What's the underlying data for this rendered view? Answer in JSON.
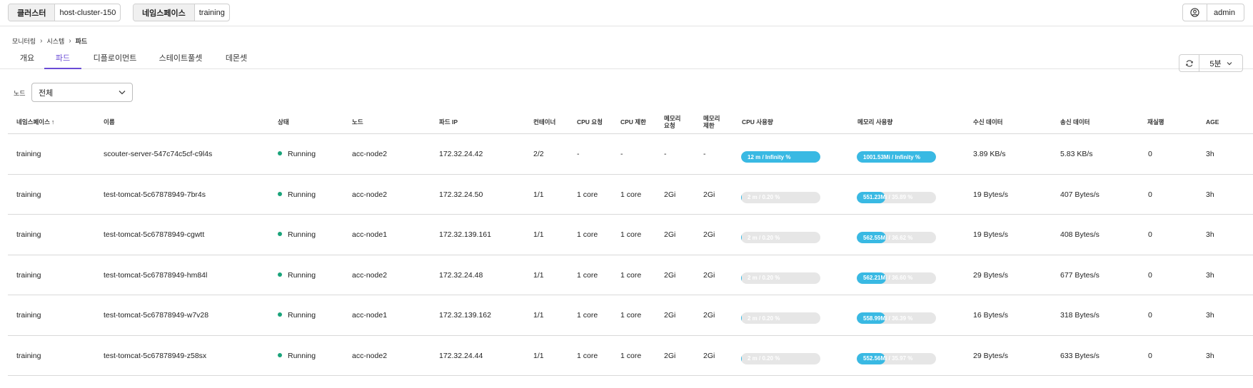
{
  "header": {
    "cluster_label": "클러스터",
    "cluster_value": "host-cluster-150",
    "namespace_label": "네임스페이스",
    "namespace_value": "training",
    "user_name": "admin"
  },
  "breadcrumb": [
    "모니터링",
    "시스템",
    "파드"
  ],
  "tabs": [
    {
      "label": "개요",
      "active": false
    },
    {
      "label": "파드",
      "active": true
    },
    {
      "label": "디플로이먼트",
      "active": false
    },
    {
      "label": "스테이트풀셋",
      "active": false
    },
    {
      "label": "데몬셋",
      "active": false
    }
  ],
  "toolbar": {
    "interval": "5분"
  },
  "filter": {
    "label": "노드",
    "value": "전체"
  },
  "columns": [
    "네임스페이스",
    "이름",
    "상태",
    "노드",
    "파드 IP",
    "컨테이너",
    "CPU 요청",
    "CPU 제한",
    "메모리 요청",
    "메모리 제한",
    "CPU 사용량",
    "메모리 사용량",
    "수신 데이터",
    "송신 데이터",
    "재실행",
    "AGE"
  ],
  "sort": {
    "column": "네임스페이스",
    "direction": "asc"
  },
  "rows": [
    {
      "namespace": "training",
      "name": "scouter-server-547c74c5cf-c9l4s",
      "status": "Running",
      "node": "acc-node2",
      "ip": "172.32.24.42",
      "containers": "2/2",
      "cpu_req": "-",
      "cpu_lim": "-",
      "mem_req": "-",
      "mem_lim": "-",
      "cpu_usage": "12 m / Infinity %",
      "cpu_pct": 100,
      "mem_usage": "1001.53Mi / Infinity %",
      "mem_pct": 100,
      "rx": "3.89 KB/s",
      "tx": "5.83 KB/s",
      "restarts": "0",
      "age": "3h"
    },
    {
      "namespace": "training",
      "name": "test-tomcat-5c67878949-7br4s",
      "status": "Running",
      "node": "acc-node2",
      "ip": "172.32.24.50",
      "containers": "1/1",
      "cpu_req": "1 core",
      "cpu_lim": "1 core",
      "mem_req": "2Gi",
      "mem_lim": "2Gi",
      "cpu_usage": "2 m / 0.20 %",
      "cpu_pct": 0.2,
      "mem_usage": "551.23Mi / 35.89 %",
      "mem_pct": 35.89,
      "rx": "19 Bytes/s",
      "tx": "407 Bytes/s",
      "restarts": "0",
      "age": "3h"
    },
    {
      "namespace": "training",
      "name": "test-tomcat-5c67878949-cgwtt",
      "status": "Running",
      "node": "acc-node1",
      "ip": "172.32.139.161",
      "containers": "1/1",
      "cpu_req": "1 core",
      "cpu_lim": "1 core",
      "mem_req": "2Gi",
      "mem_lim": "2Gi",
      "cpu_usage": "2 m / 0.20 %",
      "cpu_pct": 0.2,
      "mem_usage": "562.55Mi / 36.62 %",
      "mem_pct": 36.62,
      "rx": "19 Bytes/s",
      "tx": "408 Bytes/s",
      "restarts": "0",
      "age": "3h"
    },
    {
      "namespace": "training",
      "name": "test-tomcat-5c67878949-hm84l",
      "status": "Running",
      "node": "acc-node2",
      "ip": "172.32.24.48",
      "containers": "1/1",
      "cpu_req": "1 core",
      "cpu_lim": "1 core",
      "mem_req": "2Gi",
      "mem_lim": "2Gi",
      "cpu_usage": "2 m / 0.20 %",
      "cpu_pct": 0.2,
      "mem_usage": "562.21Mi / 36.60 %",
      "mem_pct": 36.6,
      "rx": "29 Bytes/s",
      "tx": "677 Bytes/s",
      "restarts": "0",
      "age": "3h"
    },
    {
      "namespace": "training",
      "name": "test-tomcat-5c67878949-w7v28",
      "status": "Running",
      "node": "acc-node1",
      "ip": "172.32.139.162",
      "containers": "1/1",
      "cpu_req": "1 core",
      "cpu_lim": "1 core",
      "mem_req": "2Gi",
      "mem_lim": "2Gi",
      "cpu_usage": "2 m / 0.20 %",
      "cpu_pct": 0.2,
      "mem_usage": "558.99Mi / 36.39 %",
      "mem_pct": 36.39,
      "rx": "16 Bytes/s",
      "tx": "318 Bytes/s",
      "restarts": "0",
      "age": "3h"
    },
    {
      "namespace": "training",
      "name": "test-tomcat-5c67878949-z58sx",
      "status": "Running",
      "node": "acc-node2",
      "ip": "172.32.24.44",
      "containers": "1/1",
      "cpu_req": "1 core",
      "cpu_lim": "1 core",
      "mem_req": "2Gi",
      "mem_lim": "2Gi",
      "cpu_usage": "2 m / 0.20 %",
      "cpu_pct": 0.2,
      "mem_usage": "552.56Mi / 35.97 %",
      "mem_pct": 35.97,
      "rx": "29 Bytes/s",
      "tx": "633 Bytes/s",
      "restarts": "0",
      "age": "3h"
    }
  ],
  "colors": {
    "accent": "#6a4bd6",
    "bar_fill": "#39b9e3",
    "bar_track": "#e6e6e6",
    "running": "#1aa37a"
  }
}
